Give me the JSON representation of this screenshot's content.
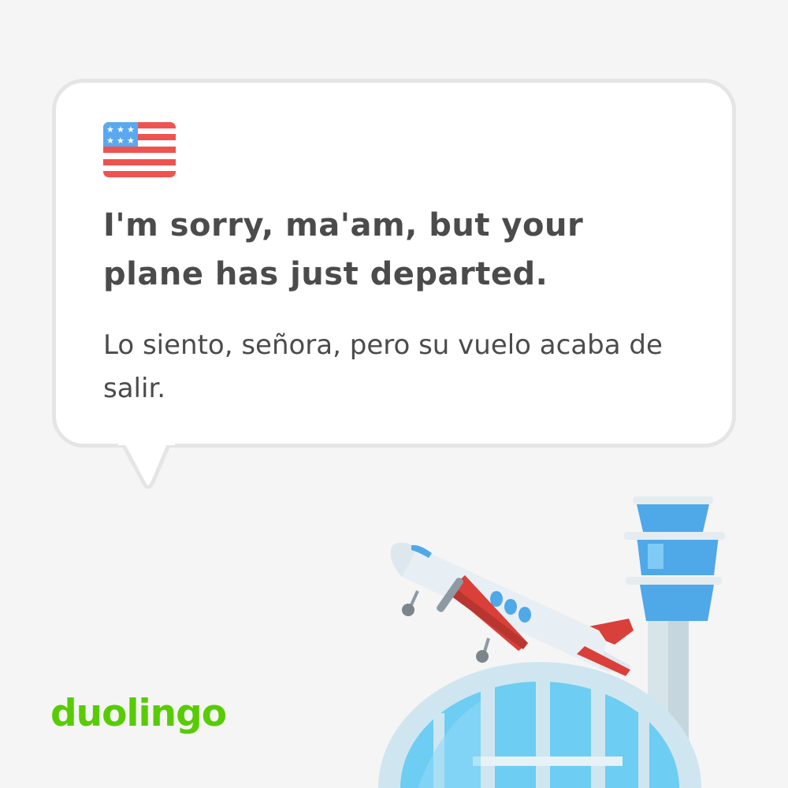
{
  "card": {
    "flag_icon": "us-flag-icon",
    "english_text": "I'm sorry, ma'am, but your plane has just departed.",
    "spanish_text": "Lo siento, señora, pero su vuelo acaba de salir."
  },
  "brand": {
    "logo_text": "duolingo",
    "color": "#58cc02"
  },
  "illustration": {
    "icons": [
      "airplane-icon",
      "control-tower-icon",
      "terminal-dome-icon"
    ]
  },
  "colors": {
    "background": "#f5f5f5",
    "bubble_border": "#e5e5e5",
    "text": "#4b4b4b",
    "flag_red": "#ef5350",
    "flag_blue": "#5aa9f0",
    "plane_red": "#d9403a",
    "glass_blue": "#4fa8e8"
  }
}
